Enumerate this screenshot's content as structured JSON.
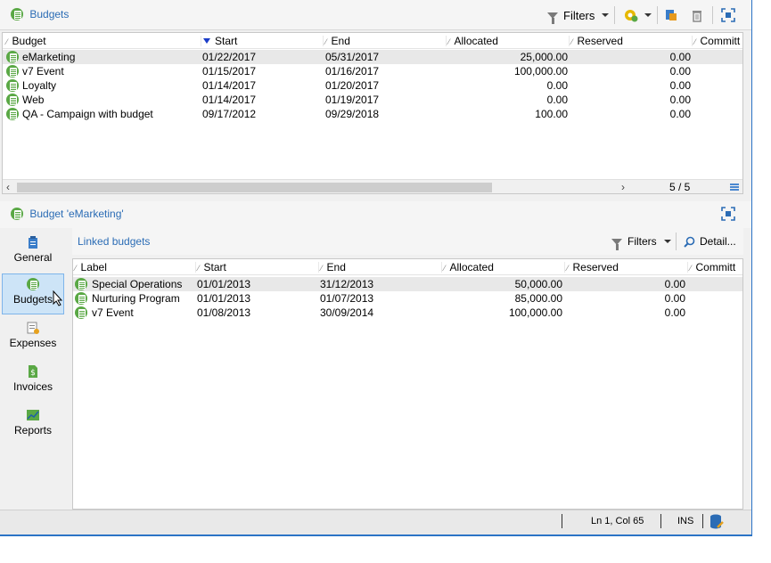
{
  "top_panel": {
    "title": "Budgets",
    "filters_label": "Filters",
    "columns": [
      "Budget",
      "Start",
      "End",
      "Allocated",
      "Reserved",
      "Committ"
    ],
    "rows": [
      {
        "budget": "eMarketing",
        "start": "01/22/2017",
        "end": "05/31/2017",
        "allocated": "25,000.00",
        "reserved": "0.00"
      },
      {
        "budget": "v7 Event",
        "start": "01/15/2017",
        "end": "01/16/2017",
        "allocated": "100,000.00",
        "reserved": "0.00"
      },
      {
        "budget": "Loyalty",
        "start": "01/14/2017",
        "end": "01/20/2017",
        "allocated": "0.00",
        "reserved": "0.00"
      },
      {
        "budget": "Web",
        "start": "01/14/2017",
        "end": "01/19/2017",
        "allocated": "0.00",
        "reserved": "0.00"
      },
      {
        "budget": "QA - Campaign with budget",
        "start": "09/17/2012",
        "end": "09/29/2018",
        "allocated": "100.00",
        "reserved": "0.00"
      }
    ],
    "page_count": "5 / 5"
  },
  "bottom_panel": {
    "title": "Budget 'eMarketing'",
    "nav": [
      {
        "label": "General"
      },
      {
        "label": "Budgets"
      },
      {
        "label": "Expenses"
      },
      {
        "label": "Invoices"
      },
      {
        "label": "Reports"
      }
    ],
    "linked_title": "Linked budgets",
    "filters_label": "Filters",
    "detail_label": "Detail...",
    "columns": [
      "Label",
      "Start",
      "End",
      "Allocated",
      "Reserved",
      "Committ"
    ],
    "rows": [
      {
        "label": "Special Operations",
        "start": "01/01/2013",
        "end": "31/12/2013",
        "allocated": "50,000.00",
        "reserved": "0.00"
      },
      {
        "label": "Nurturing Program",
        "start": "01/01/2013",
        "end": "01/07/2013",
        "allocated": "85,000.00",
        "reserved": "0.00"
      },
      {
        "label": "v7 Event",
        "start": "01/08/2013",
        "end": "30/09/2014",
        "allocated": "100,000.00",
        "reserved": "0.00"
      }
    ]
  },
  "status_bar": {
    "position": "Ln 1, Col 65",
    "mode": "INS"
  },
  "colors": {
    "accent": "#2b6cb5",
    "budget_icon": "#5aa845",
    "selection": "#cde4f7"
  }
}
